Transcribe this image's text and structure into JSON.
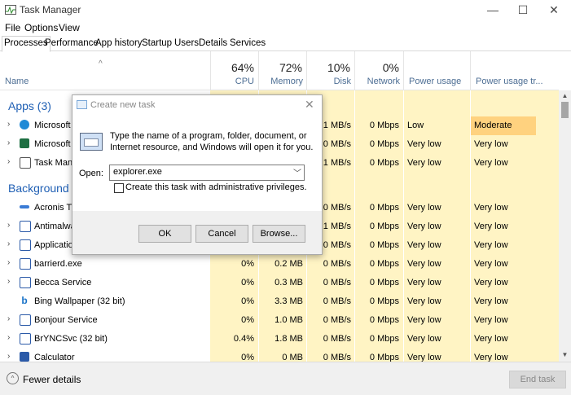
{
  "window": {
    "title": "Task Manager",
    "controls": {
      "minimize": "—",
      "maximize": "☐",
      "close": "✕"
    }
  },
  "menu": [
    "File",
    "Options",
    "View"
  ],
  "tabs": [
    "Processes",
    "Performance",
    "App history",
    "Startup",
    "Users",
    "Details",
    "Services"
  ],
  "active_tab": "Processes",
  "header": {
    "name": "Name",
    "cpu_pct": "64%",
    "cpu": "CPU",
    "memory_pct": "72%",
    "memory": "Memory",
    "disk_pct": "10%",
    "disk": "Disk",
    "network_pct": "0%",
    "network": "Network",
    "power_usage": "Power usage",
    "power_trend": "Power usage tr..."
  },
  "groups": {
    "apps": "Apps (3)",
    "background": "Background p"
  },
  "app_rows": [
    {
      "name": "Microsoft",
      "cpu": "",
      "memory": "",
      "disk": "0.1 MB/s",
      "network": "0 Mbps",
      "power": "Low",
      "trend": "Moderate"
    },
    {
      "name": "Microsoft",
      "cpu": "",
      "memory": "",
      "disk": "0 MB/s",
      "network": "0 Mbps",
      "power": "Very low",
      "trend": "Very low"
    },
    {
      "name": "Task Mana",
      "cpu": "",
      "memory": "",
      "disk": "0.1 MB/s",
      "network": "0 Mbps",
      "power": "Very low",
      "trend": "Very low"
    }
  ],
  "bg_rows": [
    {
      "name": "Acronis TIB",
      "cpu": "",
      "memory": "",
      "disk": "0 MB/s",
      "network": "0 Mbps",
      "power": "Very low",
      "trend": "Very low"
    },
    {
      "name": "Antimalwa",
      "cpu": "",
      "memory": "",
      "disk": "0.1 MB/s",
      "network": "0 Mbps",
      "power": "Very low",
      "trend": "Very low"
    },
    {
      "name": "Applicatio",
      "cpu": "",
      "memory": "",
      "disk": "0 MB/s",
      "network": "0 Mbps",
      "power": "Very low",
      "trend": "Very low"
    },
    {
      "name": "barrierd.exe",
      "cpu": "0%",
      "memory": "0.2 MB",
      "disk": "0 MB/s",
      "network": "0 Mbps",
      "power": "Very low",
      "trend": "Very low"
    },
    {
      "name": "Becca Service",
      "cpu": "0%",
      "memory": "0.3 MB",
      "disk": "0 MB/s",
      "network": "0 Mbps",
      "power": "Very low",
      "trend": "Very low"
    },
    {
      "name": "Bing Wallpaper (32 bit)",
      "cpu": "0%",
      "memory": "3.3 MB",
      "disk": "0 MB/s",
      "network": "0 Mbps",
      "power": "Very low",
      "trend": "Very low"
    },
    {
      "name": "Bonjour Service",
      "cpu": "0%",
      "memory": "1.0 MB",
      "disk": "0 MB/s",
      "network": "0 Mbps",
      "power": "Very low",
      "trend": "Very low"
    },
    {
      "name": "BrYNCSvc (32 bit)",
      "cpu": "0.4%",
      "memory": "1.8 MB",
      "disk": "0 MB/s",
      "network": "0 Mbps",
      "power": "Very low",
      "trend": "Very low"
    },
    {
      "name": "Calculator",
      "cpu": "0%",
      "memory": "0 MB",
      "disk": "0 MB/s",
      "network": "0 Mbps",
      "power": "Very low",
      "trend": "Very low"
    }
  ],
  "footer": {
    "fewer_details": "Fewer details",
    "end_task": "End task"
  },
  "dialog": {
    "title": "Create new task",
    "close": "✕",
    "description": "Type the name of a program, folder, document, or Internet resource, and Windows will open it for you.",
    "open_label": "Open:",
    "open_value": "explorer.exe",
    "admin_label": "Create this task with administrative privileges.",
    "ok": "OK",
    "cancel": "Cancel",
    "browse": "Browse..."
  },
  "colors": {
    "heat_light": "#fff4c4",
    "heat_moderate": "#ffd27f",
    "group_text": "#1f5fb4",
    "header_label": "#4d6e94"
  }
}
